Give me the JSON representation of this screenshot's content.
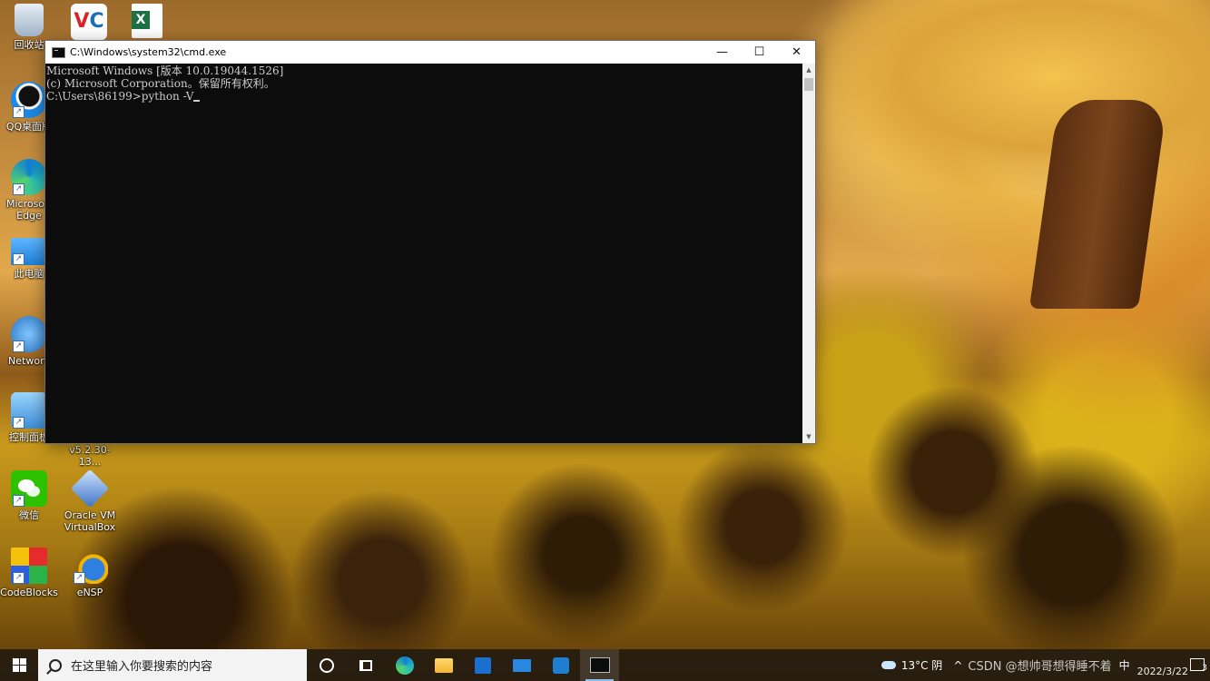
{
  "desktop": {
    "icons": [
      {
        "label": "回收站"
      },
      {
        "label": ""
      },
      {
        "label": ""
      },
      {
        "label": "QQ桌面版"
      },
      {
        "label": "Microsoft Edge"
      },
      {
        "label": "此电脑"
      },
      {
        "label": "Network"
      },
      {
        "label": "控制面板"
      },
      {
        "label": "v5.2.30-13..."
      },
      {
        "label": "微信"
      },
      {
        "label": "Oracle VM VirtualBox"
      },
      {
        "label": "CodeBlocks"
      },
      {
        "label": "eNSP"
      }
    ]
  },
  "window": {
    "title": "C:\\Windows\\system32\\cmd.exe",
    "minimize": "—",
    "maximize": "☐",
    "close": "✕",
    "lines": [
      "Microsoft Windows [版本 10.0.19044.1526]",
      "(c) Microsoft Corporation。保留所有权利。",
      "",
      "C:\\Users\\86199>python -V"
    ]
  },
  "taskbar": {
    "search_placeholder": "在这里输入你要搜索的内容",
    "apps": [
      "cortana",
      "task-view",
      "edge",
      "file-explorer",
      "store",
      "mail",
      "unknown-app",
      "cmd"
    ]
  },
  "tray": {
    "weather": "13°C 阴",
    "watermark": "CSDN @想帅哥想得睡不着",
    "ime": "中",
    "date": "2022/3/22",
    "notification_count": "3"
  }
}
